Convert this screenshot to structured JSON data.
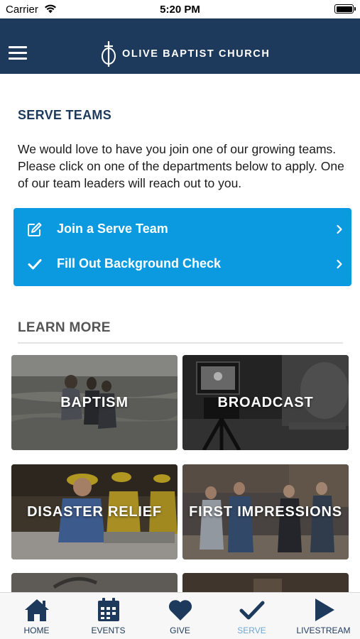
{
  "status_bar": {
    "carrier": "Carrier",
    "time": "5:20 PM"
  },
  "nav": {
    "church_name": "OLIVE BAPTIST CHURCH",
    "menu_icon": "hamburger-menu-icon",
    "logo_icon": "cross-logo-icon"
  },
  "serve": {
    "title": "SERVE TEAMS",
    "description": "We would love to have you join one of our growing teams. Please click on one of the departments below to apply. One of our team leaders will reach out to you.",
    "actions": [
      {
        "label": "Join a Serve Team",
        "icon": "edit-icon"
      },
      {
        "label": "Fill Out Background Check",
        "icon": "checkmark-icon"
      }
    ]
  },
  "learn_more": {
    "title": "LEARN MORE",
    "tiles": [
      {
        "label": "BAPTISM"
      },
      {
        "label": "BROADCAST"
      },
      {
        "label": "DISASTER RELIEF"
      },
      {
        "label": "FIRST IMPRESSIONS"
      }
    ]
  },
  "tabs": [
    {
      "label": "HOME",
      "icon": "home-icon"
    },
    {
      "label": "EVENTS",
      "icon": "calendar-icon"
    },
    {
      "label": "GIVE",
      "icon": "heart-icon"
    },
    {
      "label": "SERVE",
      "icon": "check-icon",
      "active": true
    },
    {
      "label": "LIVESTREAM",
      "icon": "play-icon"
    }
  ],
  "colors": {
    "nav_background": "#1d3a5c",
    "action_card": "#0b9ae0",
    "active_tab": "#6fa6d2",
    "tab_icon": "#1d3a5c"
  }
}
